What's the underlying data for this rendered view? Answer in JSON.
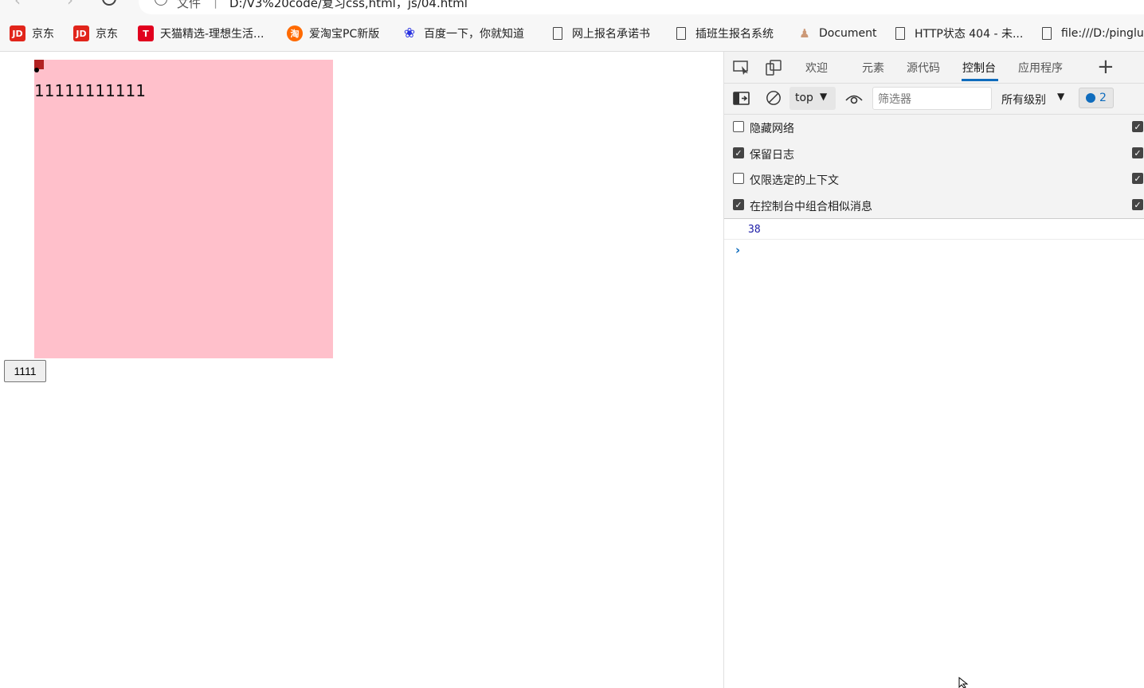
{
  "browser": {
    "address_file_label": "文件",
    "address_separator": "|",
    "address_url": "D:/V3%20code/复习css,html，js/04.html"
  },
  "bookmarks": [
    {
      "label": "京东",
      "icon": "jd-icon"
    },
    {
      "label": "京东",
      "icon": "jd-icon"
    },
    {
      "label": "天猫精选-理想生活...",
      "icon": "tmall-icon"
    },
    {
      "label": "爱淘宝PC新版",
      "icon": "taobao-icon"
    },
    {
      "label": "百度一下，你就知道",
      "icon": "baidu-paw-icon"
    },
    {
      "label": "网上报名承诺书",
      "icon": "page-icon"
    },
    {
      "label": "插班生报名系统",
      "icon": "page-icon"
    },
    {
      "label": "Document",
      "icon": "doc-figure-icon"
    },
    {
      "label": "HTTP状态 404 - 未...",
      "icon": "page-icon"
    },
    {
      "label": "file:///D:/pinglun",
      "icon": "page-icon"
    }
  ],
  "bookmark_icon_text": {
    "jd": "JD",
    "tmall": "T",
    "taobao": "淘",
    "baidu": "❀",
    "doc": "♟"
  },
  "page": {
    "box_text": "11111111111",
    "button_label": "1111",
    "box_color": "#ffc0cb"
  },
  "devtools": {
    "tabs": [
      {
        "label": "欢迎"
      },
      {
        "label": "元素"
      },
      {
        "label": "源代码"
      },
      {
        "label": "控制台",
        "active": true
      },
      {
        "label": "应用程序"
      }
    ],
    "toolbar": {
      "context": "top",
      "filter_placeholder": "筛选器",
      "levels": "所有级别",
      "issues_count": "2"
    },
    "settings": [
      {
        "label": "隐藏网络",
        "checked": false
      },
      {
        "label": "保留日志",
        "checked": true
      },
      {
        "label": "仅限选定的上下文",
        "checked": false
      },
      {
        "label": "在控制台中组合相似消息",
        "checked": true
      }
    ],
    "console_output": "38",
    "prompt": "›",
    "accent_color": "#0f6cbd"
  },
  "checkmark": "✓"
}
